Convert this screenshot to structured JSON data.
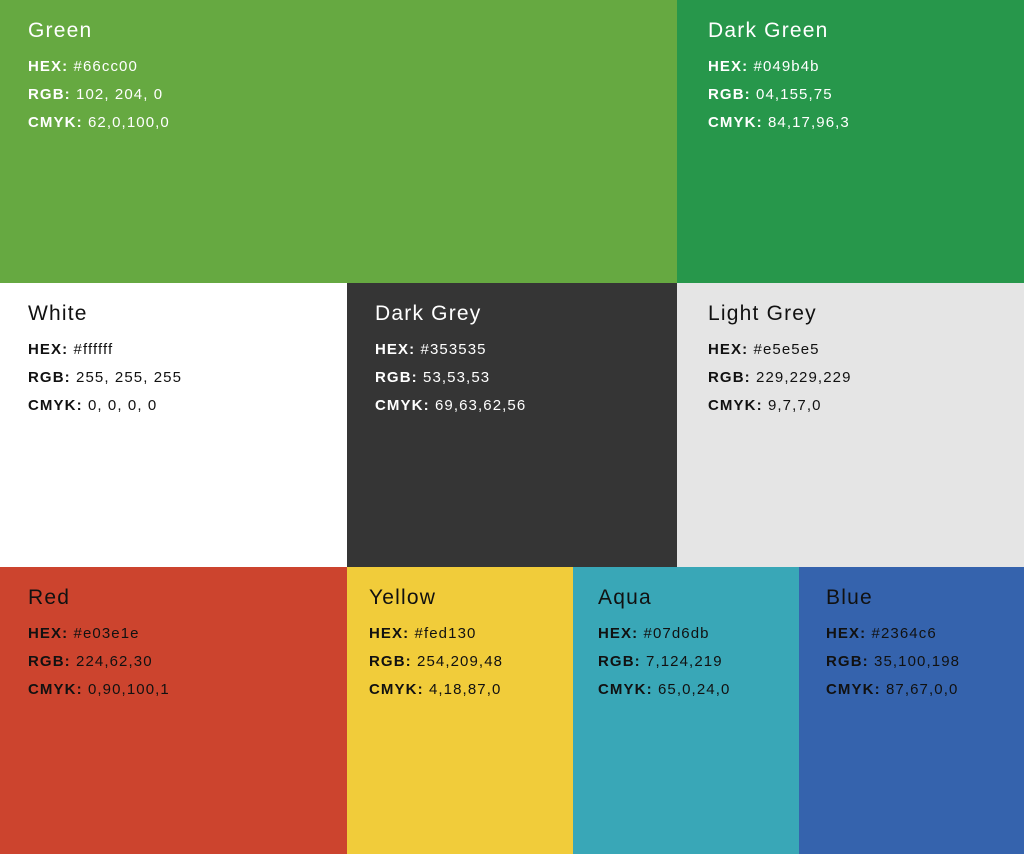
{
  "swatches": {
    "green": {
      "name": "Green",
      "bg": "#66a941",
      "text": "light",
      "hex_label": "HEX:",
      "hex": "#66cc00",
      "rgb_label": "RGB:",
      "rgb": "102, 204, 0",
      "cmyk_label": "CMYK:",
      "cmyk": "62,0,100,0"
    },
    "dark_green": {
      "name": "Dark Green",
      "bg": "#27974b",
      "text": "light",
      "hex_label": "HEX:",
      "hex": "#049b4b",
      "rgb_label": "RGB:",
      "rgb": "04,155,75",
      "cmyk_label": "CMYK:",
      "cmyk": "84,17,96,3"
    },
    "white": {
      "name": "White",
      "bg": "#ffffff",
      "text": "dark",
      "hex_label": "HEX:",
      "hex": "#ffffff",
      "rgb_label": "RGB:",
      "rgb": "255, 255, 255",
      "cmyk_label": "CMYK:",
      "cmyk": "0, 0, 0, 0"
    },
    "dark_grey": {
      "name": "Dark Grey",
      "bg": "#353535",
      "text": "light",
      "hex_label": "HEX:",
      "hex": "#353535",
      "rgb_label": "RGB:",
      "rgb": "53,53,53",
      "cmyk_label": "CMYK:",
      "cmyk": "69,63,62,56"
    },
    "light_grey": {
      "name": "Light Grey",
      "bg": "#e5e5e5",
      "text": "dark",
      "hex_label": "HEX:",
      "hex": "#e5e5e5",
      "rgb_label": "RGB:",
      "rgb": "229,229,229",
      "cmyk_label": "CMYK:",
      "cmyk": "9,7,7,0"
    },
    "red": {
      "name": "Red",
      "bg": "#cc442e",
      "text": "dark",
      "hex_label": "HEX:",
      "hex": "#e03e1e",
      "rgb_label": "RGB:",
      "rgb": "224,62,30",
      "cmyk_label": "CMYK:",
      "cmyk": "0,90,100,1"
    },
    "yellow": {
      "name": "Yellow",
      "bg": "#f1cc3a",
      "text": "dark",
      "hex_label": "HEX:",
      "hex": "#fed130",
      "rgb_label": "RGB:",
      "rgb": "254,209,48",
      "cmyk_label": "CMYK:",
      "cmyk": "4,18,87,0"
    },
    "aqua": {
      "name": "Aqua",
      "bg": "#39a7b7",
      "text": "dark",
      "hex_label": "HEX:",
      "hex": "#07d6db",
      "rgb_label": "RGB:",
      "rgb": "7,124,219",
      "cmyk_label": "CMYK:",
      "cmyk": "65,0,24,0"
    },
    "blue": {
      "name": "Blue",
      "bg": "#3563ad",
      "text": "dark",
      "hex_label": "HEX:",
      "hex": "#2364c6",
      "rgb_label": "RGB:",
      "rgb": "35,100,198",
      "cmyk_label": "CMYK:",
      "cmyk": "87,67,0,0"
    }
  }
}
